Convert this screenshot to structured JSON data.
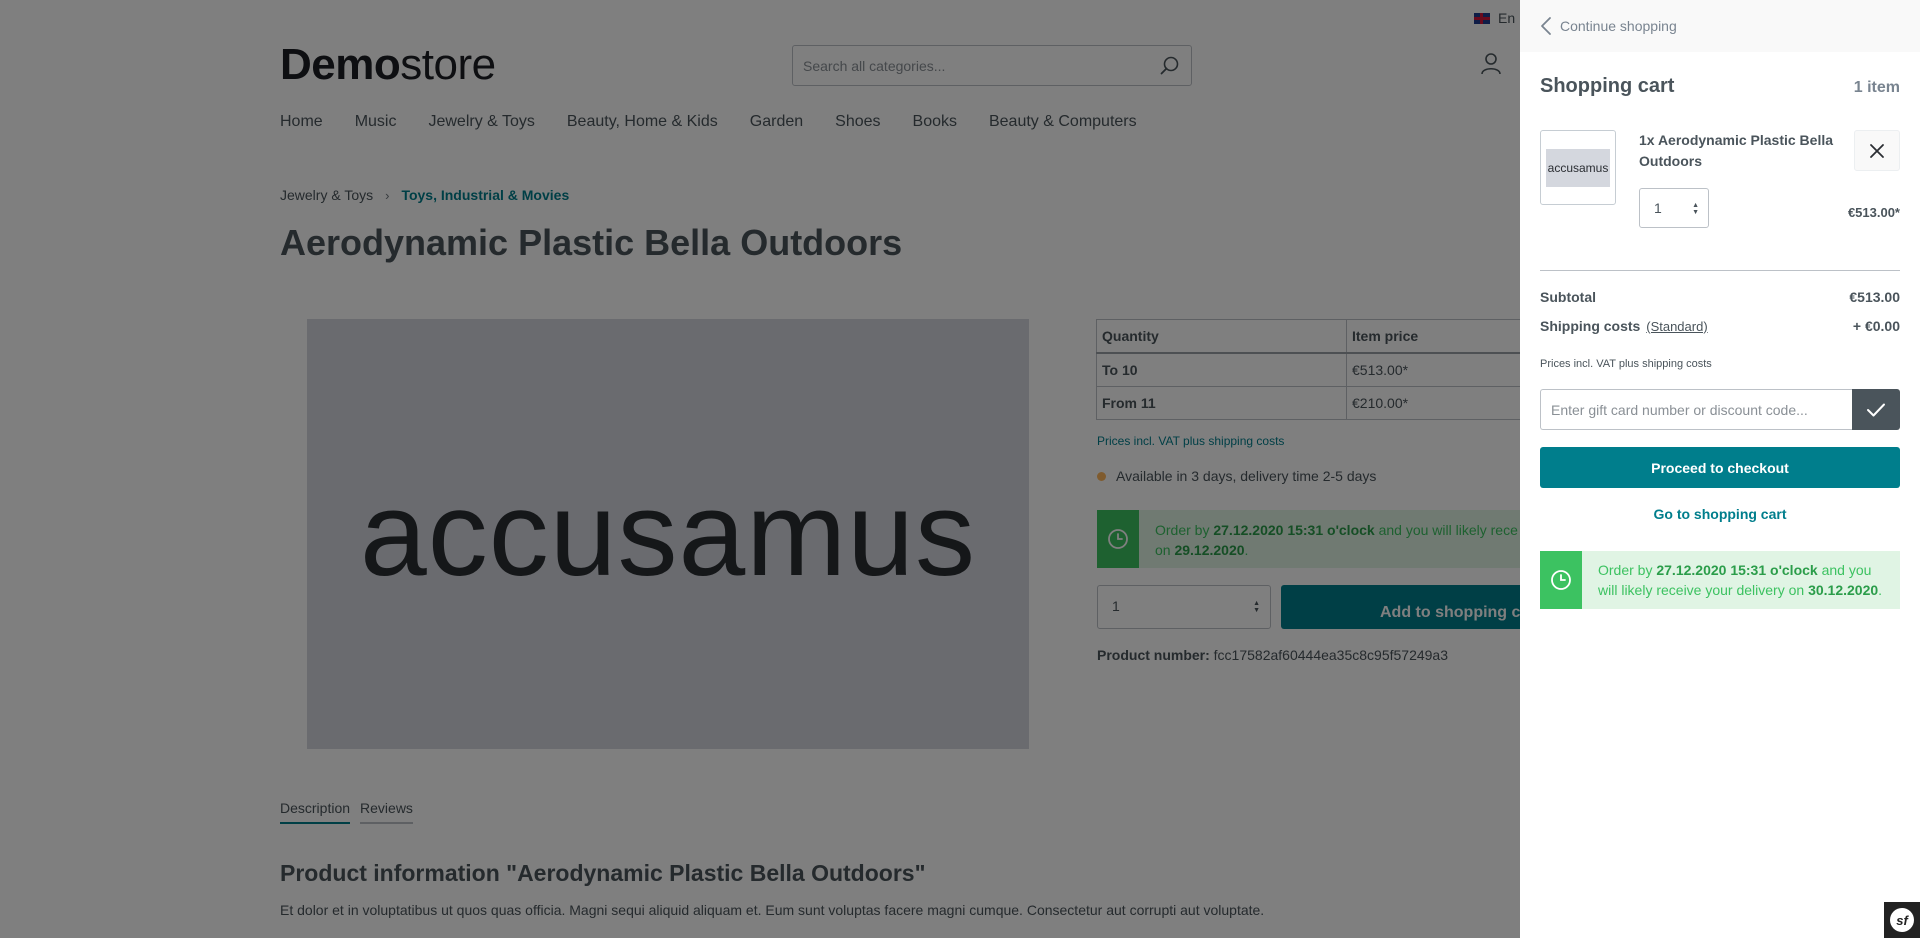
{
  "header": {
    "language": "En",
    "logo_bold": "Demo",
    "logo_light": "store",
    "search_placeholder": "Search all categories..."
  },
  "nav": [
    "Home",
    "Music",
    "Jewelry & Toys",
    "Beauty, Home & Kids",
    "Garden",
    "Shoes",
    "Books",
    "Beauty & Computers"
  ],
  "breadcrumb": {
    "parent": "Jewelry & Toys",
    "separator": "›",
    "current": "Toys, Industrial & Movies"
  },
  "product": {
    "title": "Aerodynamic Plastic Bella Outdoors",
    "image_text": "accusamus",
    "price_table": {
      "headers": [
        "Quantity",
        "Item price"
      ],
      "rows": [
        [
          "To 10",
          "€513.00*"
        ],
        [
          "From 11",
          "€210.00*"
        ]
      ]
    },
    "vat_note": "Prices incl. VAT plus shipping costs",
    "availability": "Available in 3 days, delivery time 2-5 days",
    "delivery": {
      "pre": "Order by ",
      "deadline": "27.12.2020 15:31 o'clock",
      "mid": " and you will likely rece",
      "on": "on ",
      "date": "29.12.2020",
      "end": "."
    },
    "qty": "1",
    "add_to_cart": "Add to shopping cart",
    "number_label": "Product number:",
    "number_value": "fcc17582af60444ea35c8c95f57249a3"
  },
  "tabs": [
    "Description",
    "Reviews"
  ],
  "info": {
    "title": "Product information \"Aerodynamic Plastic Bella Outdoors\"",
    "text": "Et dolor et in voluptatibus ut quos quas officia. Magni sequi aliquid aliquam et. Eum sunt voluptas facere magni cumque. Consectetur aut corrupti aut voluptate."
  },
  "cart": {
    "continue": "Continue shopping",
    "title": "Shopping cart",
    "count": "1 item",
    "item": {
      "image_text": "accusamus",
      "name": "1x Aerodynamic Plastic Bella Outdoors",
      "qty": "1",
      "price": "€513.00*"
    },
    "subtotal_label": "Subtotal",
    "subtotal_value": "€513.00",
    "shipping_label": "Shipping costs",
    "shipping_method": "(Standard)",
    "shipping_value": "+ €0.00",
    "vat_note": "Prices incl. VAT plus shipping costs",
    "code_placeholder": "Enter gift card number or discount code...",
    "checkout": "Proceed to checkout",
    "goto_cart": "Go to shopping cart",
    "delivery": {
      "pre": "Order by ",
      "deadline": "27.12.2020 15:31 o'clock",
      "mid": " and you will likely receive your delivery on ",
      "date": "30.12.2020",
      "end": "."
    }
  },
  "colors": {
    "primary": "#007e8c",
    "success": "#3cc261",
    "warning_dot": "#ffb75d",
    "text": "#4a545b"
  },
  "icons": [
    "flag-uk-icon",
    "search-icon",
    "account-icon",
    "chevron-left-icon",
    "close-icon",
    "checkmark-icon",
    "clock-icon",
    "symfony-icon"
  ],
  "debug_badge": "sf"
}
